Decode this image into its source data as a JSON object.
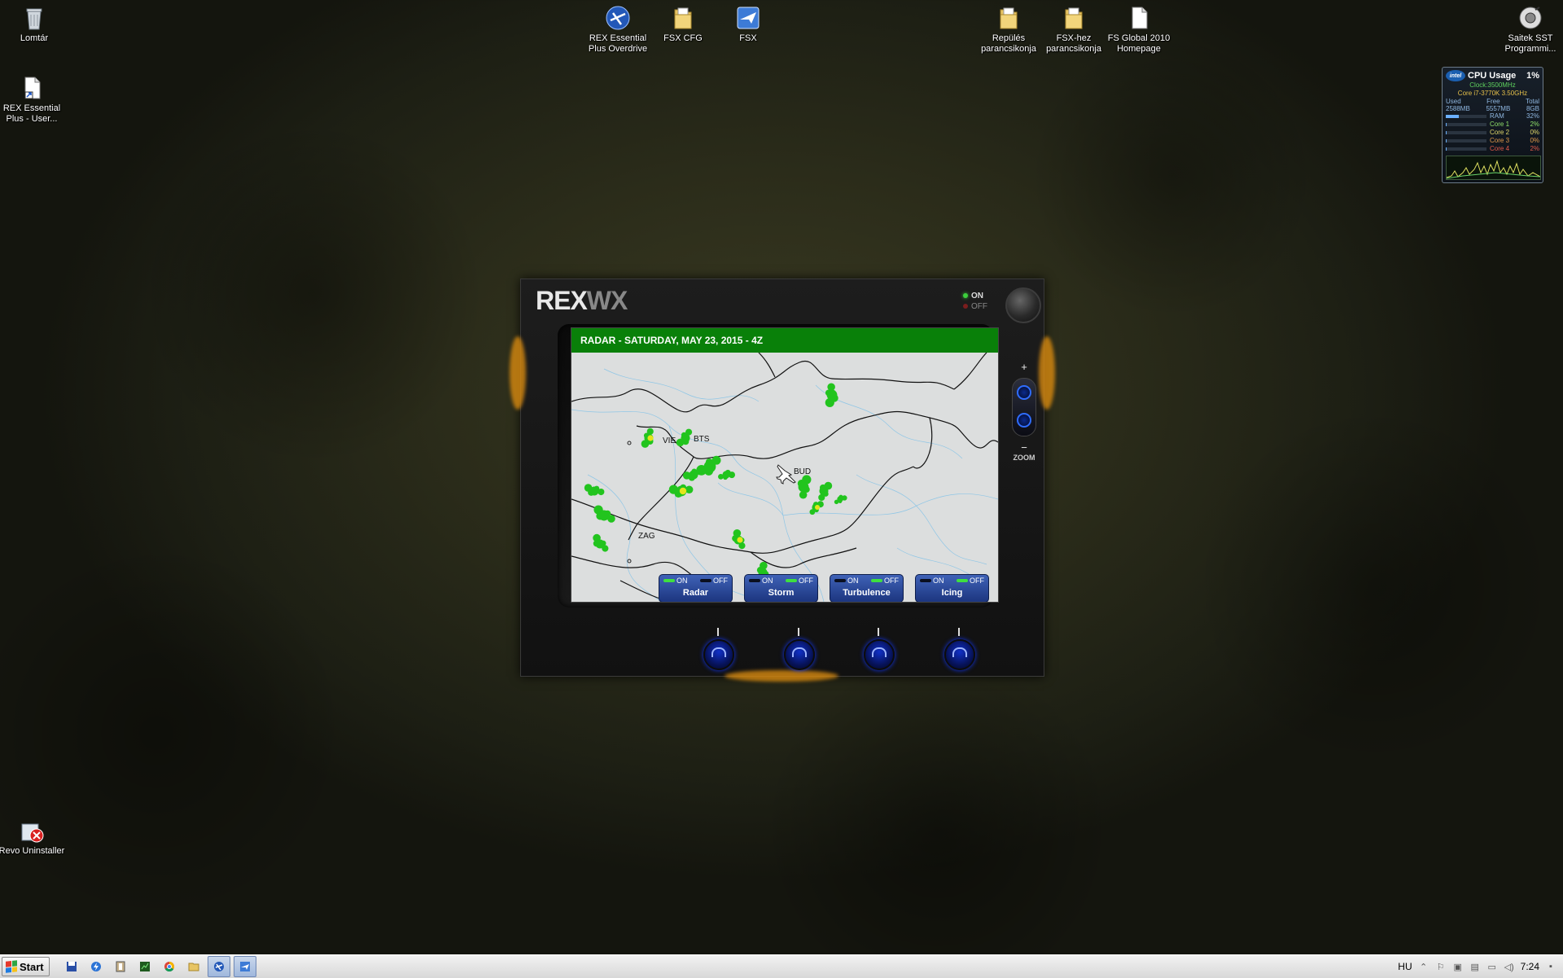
{
  "desktop": {
    "icons": [
      {
        "label": "Lomtár",
        "icon": "recycle-bin-icon"
      },
      {
        "label": "REX Essential Plus - User...",
        "icon": "shortcut-document-icon"
      },
      {
        "label": "REX Essential Plus Overdrive",
        "icon": "rex-overdrive-icon"
      },
      {
        "label": "FSX CFG",
        "icon": "folder-icon"
      },
      {
        "label": "FSX",
        "icon": "fsx-app-icon"
      },
      {
        "label": "Repülés parancsikonja",
        "icon": "folder-icon"
      },
      {
        "label": "FSX-hez parancsikonja",
        "icon": "folder-icon"
      },
      {
        "label": "FS Global 2010 Homepage",
        "icon": "document-icon"
      },
      {
        "label": "Saitek SST Programmi...",
        "icon": "saitek-icon"
      },
      {
        "label": "Revo Uninstaller",
        "icon": "revo-uninstaller-icon"
      }
    ]
  },
  "cpu_gadget": {
    "brand": "intel",
    "title": "CPU Usage",
    "percent": "1%",
    "clock": "Clock:3500MHz",
    "model": "Core i7-3770K 3.50GHz",
    "mem_headers": [
      "Used",
      "Free",
      "Total"
    ],
    "mem_values": [
      "2588MB",
      "5557MB",
      "8GB"
    ],
    "rows": [
      {
        "name": "RAM",
        "value": "32%",
        "fill": 0.32,
        "color": "#8fb7e0"
      },
      {
        "name": "Core 1",
        "value": "2%",
        "fill": 0.02,
        "color": "#8fe06b"
      },
      {
        "name": "Core 2",
        "value": "0%",
        "fill": 0.0,
        "color": "#e0d86b"
      },
      {
        "name": "Core 3",
        "value": "0%",
        "fill": 0.0,
        "color": "#e09a4b"
      },
      {
        "name": "Core 4",
        "value": "2%",
        "fill": 0.02,
        "color": "#e05b4b"
      }
    ]
  },
  "rexwx": {
    "logo_primary": "REX",
    "logo_secondary": "WX",
    "power_on": "ON",
    "power_off": "OFF",
    "screen_title": "RADAR - SATURDAY, MAY 23, 2015 - 4Z",
    "cities": [
      "VIE",
      "BTS",
      "BUD",
      "ZAG"
    ],
    "toggles": [
      {
        "name": "Radar",
        "on": "ON",
        "off": "OFF",
        "state": "on"
      },
      {
        "name": "Storm",
        "on": "ON",
        "off": "OFF",
        "state": "off"
      },
      {
        "name": "Turbulence",
        "on": "ON",
        "off": "OFF",
        "state": "off"
      },
      {
        "name": "Icing",
        "on": "ON",
        "off": "OFF",
        "state": "off"
      }
    ],
    "zoom_plus": "+",
    "zoom_minus": "−",
    "zoom_label": "ZOOM",
    "colors": {
      "header_green": "#098009",
      "radar_green": "#22c41e",
      "radar_yellow": "#e5e51c",
      "button_blue": "#2f55b0"
    }
  },
  "taskbar": {
    "start_label": "Start",
    "language": "HU",
    "time": "7:24",
    "apps": [
      "save-icon",
      "flash-icon",
      "book-icon",
      "green-app-icon",
      "chrome-icon",
      "explorer-icon",
      "rex-icon",
      "fsx-icon"
    ]
  }
}
